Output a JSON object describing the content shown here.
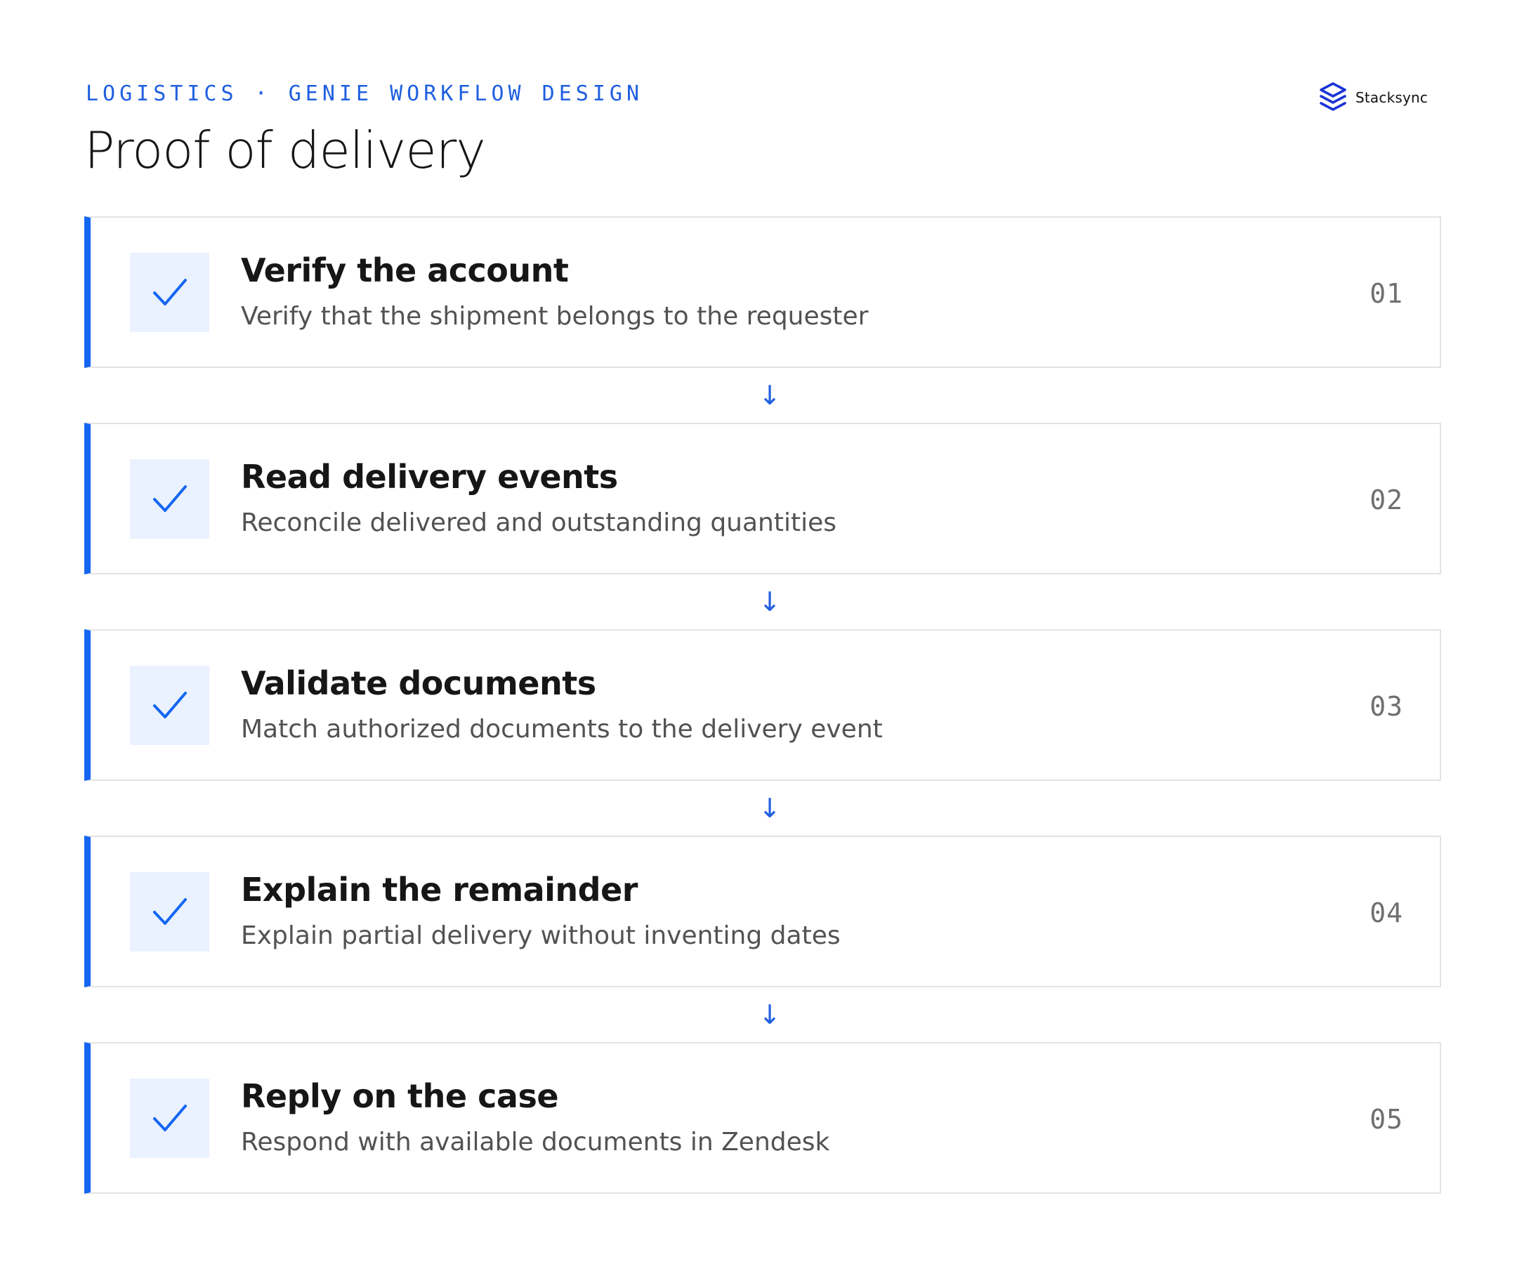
{
  "header": {
    "eyebrow": "LOGISTICS · GENIE WORKFLOW DESIGN",
    "title": "Proof of delivery"
  },
  "brand": {
    "name": "Stacksync",
    "logo_icon": "stacked-layers-logo-icon"
  },
  "colors": {
    "accent": "#1466f2",
    "eyebrow": "#1f5fe0",
    "check_bg": "#eaf2ff",
    "border": "#e3e3e3",
    "title": "#161616",
    "description": "#525252",
    "number": "#6f6f6f"
  },
  "connector_icon": "arrow-down-icon",
  "steps": [
    {
      "number": "01",
      "title": "Verify the account",
      "description": "Verify that the shipment belongs to the requester",
      "icon": "checkmark-icon"
    },
    {
      "number": "02",
      "title": "Read delivery events",
      "description": "Reconcile delivered and outstanding quantities",
      "icon": "checkmark-icon"
    },
    {
      "number": "03",
      "title": "Validate documents",
      "description": "Match authorized documents to the delivery event",
      "icon": "checkmark-icon"
    },
    {
      "number": "04",
      "title": "Explain the remainder",
      "description": "Explain partial delivery without inventing dates",
      "icon": "checkmark-icon"
    },
    {
      "number": "05",
      "title": "Reply on the case",
      "description": "Respond with available documents in Zendesk",
      "icon": "checkmark-icon"
    }
  ]
}
